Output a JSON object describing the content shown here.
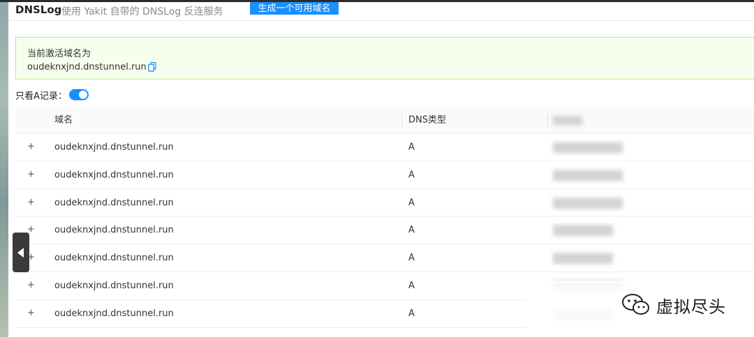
{
  "header": {
    "title": "DNSLog",
    "subtitle": "使用 Yakit 自带的 DNSLog 反连服务",
    "generate_button": "生成一个可用域名"
  },
  "alert": {
    "label": "当前激活域名为",
    "domain": "oudeknxjnd.dnstunnel.run"
  },
  "filter": {
    "label": "只看A记录：",
    "toggle_on": true
  },
  "table": {
    "columns": [
      "域名",
      "DNS类型",
      ""
    ],
    "rows": [
      {
        "domain": "oudeknxjnd.dnstunnel.run",
        "type": "A"
      },
      {
        "domain": "oudeknxjnd.dnstunnel.run",
        "type": "A"
      },
      {
        "domain": "oudeknxjnd.dnstunnel.run",
        "type": "A"
      },
      {
        "domain": "oudeknxjnd.dnstunnel.run",
        "type": "A"
      },
      {
        "domain": "oudeknxjnd.dnstunnel.run",
        "type": "A"
      },
      {
        "domain": "oudeknxjnd.dnstunnel.run",
        "type": "A"
      },
      {
        "domain": "oudeknxjnd.dnstunnel.run",
        "type": "A"
      }
    ],
    "expand_symbol": "+"
  },
  "watermark": {
    "text": "虚拟尽头",
    "icon": "wechat-icon"
  },
  "colors": {
    "primary": "#1890ff",
    "alert_bg": "#f6ffed",
    "alert_border": "#b7eb8f"
  }
}
